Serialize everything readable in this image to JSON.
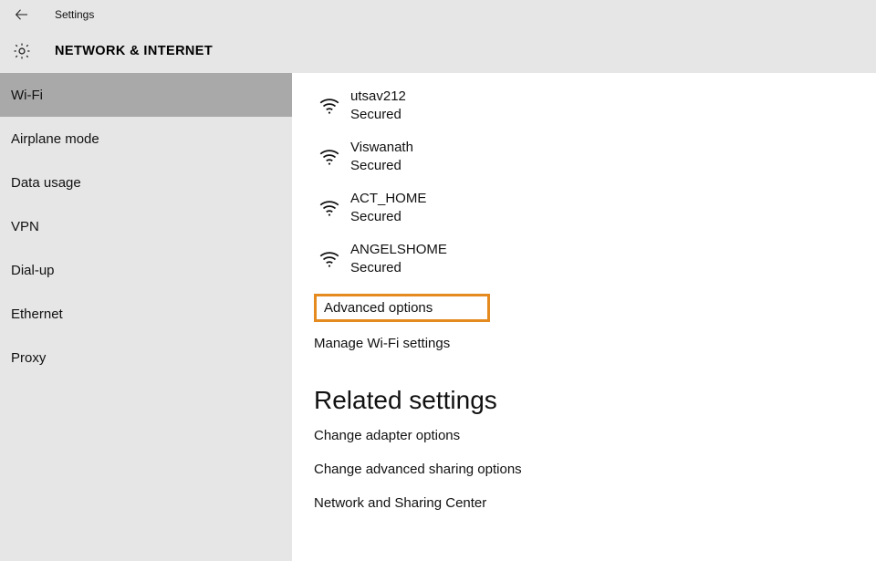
{
  "titlebar": {
    "title": "Settings"
  },
  "header": {
    "section": "NETWORK & INTERNET"
  },
  "sidebar": {
    "items": [
      {
        "label": "Wi-Fi",
        "active": true
      },
      {
        "label": "Airplane mode",
        "active": false
      },
      {
        "label": "Data usage",
        "active": false
      },
      {
        "label": "VPN",
        "active": false
      },
      {
        "label": "Dial-up",
        "active": false
      },
      {
        "label": "Ethernet",
        "active": false
      },
      {
        "label": "Proxy",
        "active": false
      }
    ]
  },
  "networks": [
    {
      "ssid": "utsav212",
      "status": "Secured"
    },
    {
      "ssid": "Viswanath",
      "status": "Secured"
    },
    {
      "ssid": "ACT_HOME",
      "status": "Secured"
    },
    {
      "ssid": "ANGELSHOME",
      "status": "Secured"
    }
  ],
  "links": {
    "advanced_options": "Advanced options",
    "manage_wifi": "Manage Wi-Fi settings",
    "related_heading": "Related settings",
    "change_adapter": "Change adapter options",
    "change_sharing": "Change advanced sharing options",
    "network_center": "Network and Sharing Center"
  }
}
